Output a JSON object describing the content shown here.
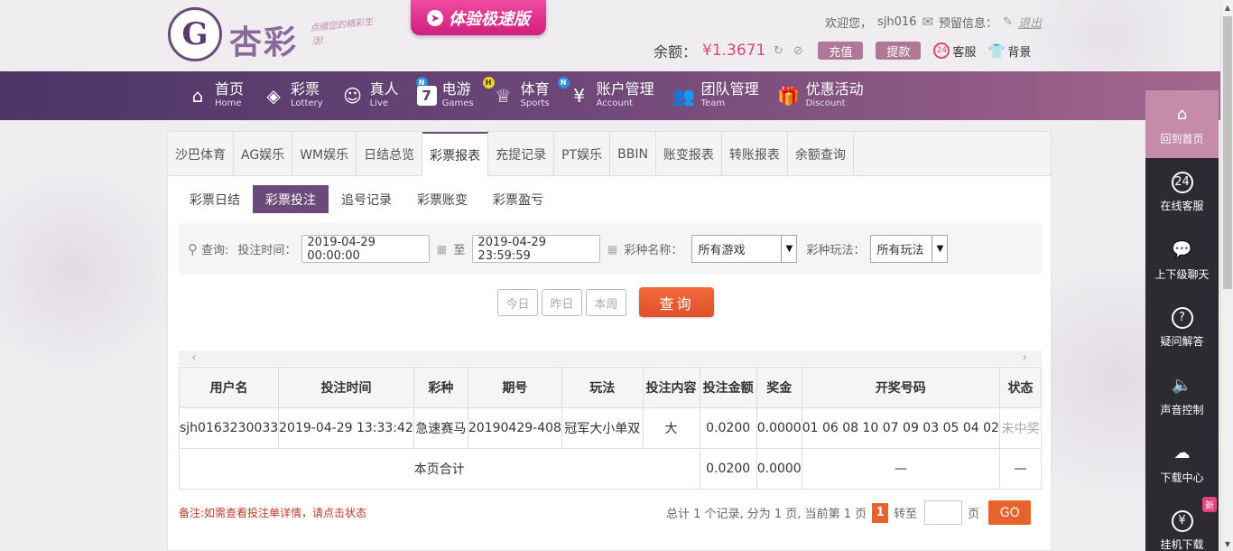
{
  "header": {
    "logo_text": "杏彩",
    "logo_slogan": "点缀您的精彩生活!",
    "speed_button": "体验极速版",
    "welcome_label": "欢迎您，",
    "username": "sjh016",
    "message_label": "预留信息：",
    "logout": "退出",
    "balance_label": "余额：",
    "balance_value": "¥1.3671",
    "recharge": "充值",
    "withdraw": "提款",
    "service": "客服",
    "background": "背景"
  },
  "nav": [
    {
      "cn": "首页",
      "en": "Home",
      "icon": "home-icon"
    },
    {
      "cn": "彩票",
      "en": "Lottery",
      "icon": "lottery-ticket-icon"
    },
    {
      "cn": "真人",
      "en": "Live",
      "icon": "live-dealer-icon",
      "badge": "N"
    },
    {
      "cn": "电游",
      "en": "Games",
      "icon": "slot-seven-icon",
      "badge": "H"
    },
    {
      "cn": "体育",
      "en": "Sports",
      "icon": "trophy-icon",
      "badge": "N"
    },
    {
      "cn": "账户管理",
      "en": "Account",
      "icon": "yen-coin-icon"
    },
    {
      "cn": "团队管理",
      "en": "Team",
      "icon": "team-icon"
    },
    {
      "cn": "优惠活动",
      "en": "Discount",
      "icon": "gift-icon"
    }
  ],
  "tabs": [
    "沙巴体育",
    "AG娱乐",
    "WM娱乐",
    "日结总览",
    "彩票报表",
    "充提记录",
    "PT娱乐",
    "BBIN",
    "账变报表",
    "转账报表",
    "余额查询"
  ],
  "active_tab": "彩票报表",
  "subtabs": [
    "彩票日结",
    "彩票投注",
    "追号记录",
    "彩票账变",
    "彩票盈亏"
  ],
  "active_subtab": "彩票投注",
  "filter": {
    "query_label": "查询:",
    "time_label": "投注时间：",
    "start_time": "2019-04-29 00:00:00",
    "to_label": "至",
    "end_time": "2019-04-29 23:59:59",
    "game_label": "彩种名称：",
    "game_value": "所有游戏",
    "play_label": "彩种玩法：",
    "play_value": "所有玩法"
  },
  "quick_buttons": [
    "今日",
    "昨日",
    "本周"
  ],
  "query_button": "查询",
  "table": {
    "columns": [
      "用户名",
      "投注时间",
      "彩种",
      "期号",
      "玩法",
      "投注内容",
      "投注金额",
      "奖金",
      "开奖号码",
      "状态"
    ],
    "rows": [
      [
        "sjh0163230033",
        "2019-04-29 13:33:42",
        "急速赛马",
        "20190429-408",
        "冠军大小单双",
        "大",
        "0.0200",
        "0.0000",
        "01 06 08 10 07 09 03 05 04 02",
        "未中奖"
      ]
    ],
    "summary": {
      "label": "本页合计",
      "amount": "0.0200",
      "prize": "0.0000",
      "numbers": "—",
      "status": "—"
    }
  },
  "note": "备注:如需查看投注单详情，请点击状态",
  "pager": {
    "text": "总计 1 个记录, 分为 1 页, 当前第 1 页",
    "current": "1",
    "goto_label": "转至",
    "page_label": "页",
    "go": "GO"
  },
  "sidebar": [
    {
      "label": "回到首页",
      "icon": "home-icon"
    },
    {
      "label": "在线客服",
      "icon": "headset-icon"
    },
    {
      "label": "上下级聊天",
      "icon": "chat-bubble-icon"
    },
    {
      "label": "疑问解答",
      "icon": "question-icon"
    },
    {
      "label": "声音控制",
      "icon": "speaker-icon"
    },
    {
      "label": "下载中心",
      "icon": "cloud-download-icon"
    },
    {
      "label": "挂机下载",
      "icon": "money-bag-icon",
      "badge": "新"
    }
  ]
}
